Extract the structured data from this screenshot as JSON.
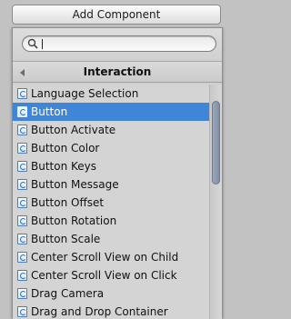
{
  "add_component_button": {
    "label": "Add Component"
  },
  "search": {
    "value": "",
    "placeholder": ""
  },
  "section": {
    "title": "Interaction"
  },
  "items": [
    {
      "label": "Language Selection",
      "icon": "csharp-script-icon",
      "selected": false
    },
    {
      "label": "Button",
      "icon": "csharp-script-icon",
      "selected": true
    },
    {
      "label": "Button Activate",
      "icon": "csharp-script-icon",
      "selected": false
    },
    {
      "label": "Button Color",
      "icon": "csharp-script-icon",
      "selected": false
    },
    {
      "label": "Button Keys",
      "icon": "csharp-script-icon",
      "selected": false
    },
    {
      "label": "Button Message",
      "icon": "csharp-script-icon",
      "selected": false
    },
    {
      "label": "Button Offset",
      "icon": "csharp-script-icon",
      "selected": false
    },
    {
      "label": "Button Rotation",
      "icon": "csharp-script-icon",
      "selected": false
    },
    {
      "label": "Button Scale",
      "icon": "csharp-script-icon",
      "selected": false
    },
    {
      "label": "Center Scroll View on Child",
      "icon": "csharp-script-icon",
      "selected": false
    },
    {
      "label": "Center Scroll View on Click",
      "icon": "csharp-script-icon",
      "selected": false
    },
    {
      "label": "Drag Camera",
      "icon": "csharp-script-icon",
      "selected": false
    },
    {
      "label": "Drag and Drop Container",
      "icon": "csharp-script-icon",
      "selected": false
    }
  ],
  "colors": {
    "selection": "#3f86d8",
    "panel": "#d0d0d0",
    "background": "#c2c2c2"
  }
}
